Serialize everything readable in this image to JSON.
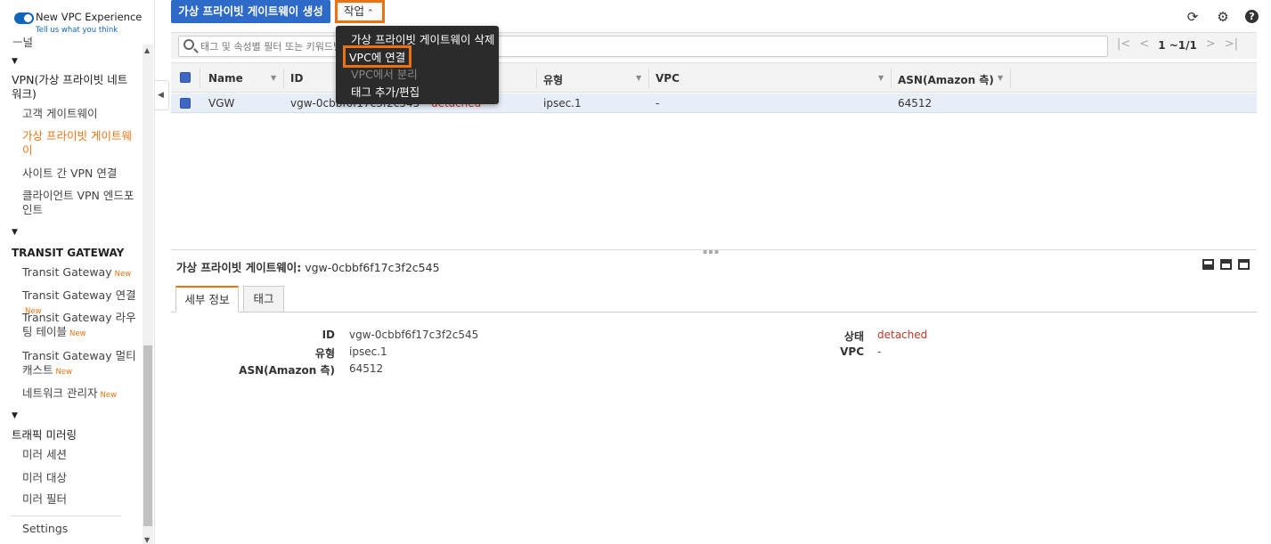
{
  "sidebar": {
    "vpc_toggle_label": "New VPC Experience",
    "vpc_toggle_sub": "Tell us what you think",
    "partial_top": "ㅡ널",
    "sections": [
      {
        "heading": "VPN(가상 프라이빗 네트워크)"
      },
      {
        "heading": "TRANSIT GATEWAY"
      },
      {
        "heading": "트래픽 미러링"
      }
    ],
    "items": [
      {
        "label": "고객 게이트웨이"
      },
      {
        "label": "가상 프라이빗 게이트웨이"
      },
      {
        "label": "사이트 간 VPN 연결"
      },
      {
        "label": "클라이언트 VPN 엔드포인트"
      },
      {
        "label": "Transit Gateway",
        "badge": "New"
      },
      {
        "label": "Transit Gateway 연결",
        "badge": "New"
      },
      {
        "label": "Transit Gateway 라우팅 테이블",
        "badge": "New"
      },
      {
        "label": "Transit Gateway 멀티캐스트",
        "badge": "New"
      },
      {
        "label": "네트워크 관리자",
        "badge": "New"
      },
      {
        "label": "미러 세션"
      },
      {
        "label": "미러 대상"
      },
      {
        "label": "미러 필터"
      },
      {
        "label": "Settings"
      }
    ]
  },
  "toolbar": {
    "create_label": "가상 프라이빗 게이트웨이 생성",
    "actions_label": "작업"
  },
  "actions_menu": {
    "items": [
      {
        "label": "가상 프라이빗 게이트웨이 삭제",
        "enabled": true
      },
      {
        "label": "VPC에 연결",
        "enabled": true,
        "highlighted": true
      },
      {
        "label": "VPC에서 분리",
        "enabled": false
      },
      {
        "label": "태그 추가/편집",
        "enabled": true
      }
    ]
  },
  "filter": {
    "placeholder": "태그 및 속성별 필터 또는 키워드별 검색",
    "page_count": "1 ~1/1"
  },
  "table": {
    "columns": [
      "Name",
      "ID",
      "상태",
      "유형",
      "VPC",
      "ASN(Amazon 측)"
    ],
    "rows": [
      {
        "name": "VGW",
        "id": "vgw-0cbbf6f17c3f2c545",
        "state": "detached",
        "type": "ipsec.1",
        "vpc": "-",
        "asn": "64512"
      }
    ]
  },
  "detail": {
    "title_label": "가상 프라이빗 게이트웨이:",
    "title_value": "vgw-0cbbf6f17c3f2c545",
    "tabs": [
      "세부 정보",
      "태그"
    ],
    "left": [
      {
        "label": "ID",
        "value": "vgw-0cbbf6f17c3f2c545"
      },
      {
        "label": "유형",
        "value": "ipsec.1"
      },
      {
        "label": "ASN(Amazon 측)",
        "value": "64512"
      }
    ],
    "right": [
      {
        "label": "상태",
        "value": "detached"
      },
      {
        "label": "VPC",
        "value": "-"
      }
    ]
  },
  "colors": {
    "primary": "#2e6ac8",
    "highlight": "#ec7211",
    "danger": "#c0392b"
  }
}
